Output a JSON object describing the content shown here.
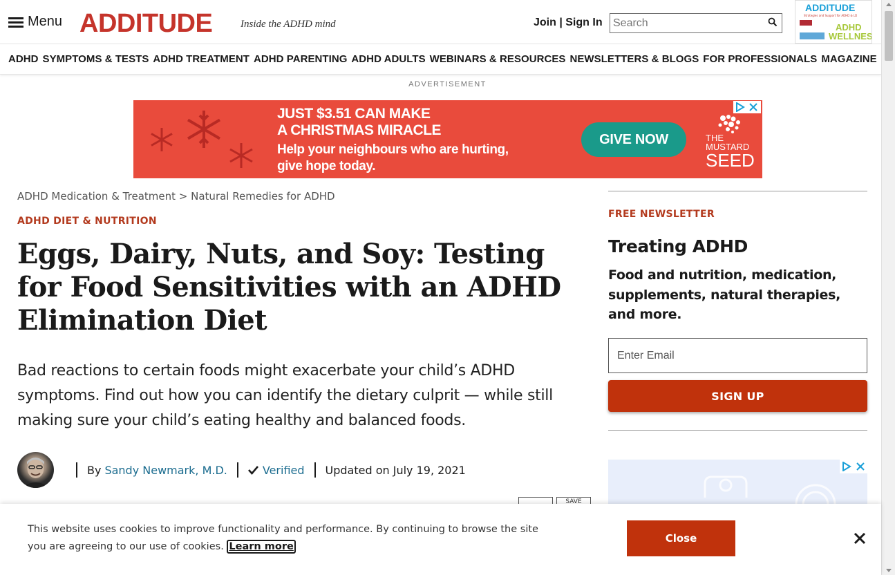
{
  "header": {
    "menu_label": "Menu",
    "logo": "ADDITUDE",
    "tagline": "Inside the ADHD mind",
    "join_signin": "Join | Sign In",
    "search_placeholder": "Search",
    "magazine": {
      "title": "ADDITUDE",
      "subtitle": "Strategies and Support for ADHD & LD",
      "wellness_line1": "ADHD",
      "wellness_line2": "WELLNESS"
    }
  },
  "nav": {
    "items": [
      "ADHD",
      "SYMPTOMS & TESTS",
      "ADHD TREATMENT",
      "ADHD PARENTING",
      "ADHD ADULTS",
      "WEBINARS & RESOURCES",
      "NEWSLETTERS & BLOGS",
      "FOR PROFESSIONALS",
      "MAGAZINE"
    ]
  },
  "ad": {
    "label": "ADVERTISEMENT",
    "headline_1": "JUST $3.51 CAN MAKE",
    "headline_2": "A CHRISTMAS MIRACLE",
    "sub_1": "Help your neighbours who are hurting,",
    "sub_2": "give hope today.",
    "cta": "GIVE NOW",
    "brand_1": "THE",
    "brand_2": "MUSTARD",
    "brand_3": "SEED"
  },
  "article": {
    "breadcrumb_1": "ADHD Medication & Treatment",
    "breadcrumb_sep": ">",
    "breadcrumb_2": "Natural Remedies for ADHD",
    "category": "ADHD DIET & NUTRITION",
    "title": "Eggs, Dairy, Nuts, and Soy: Testing for Food Sensitivities with an ADHD Elimination Diet",
    "subtitle": "Bad reactions to certain foods might exacerbate your child’s ADHD symptoms. Find out how you can identify the dietary culprit — while still making sure your child’s eating healthy and balanced foods.",
    "by": "By",
    "author": "Sandy Newmark, M.D.",
    "verified": "Verified",
    "updated": "Updated on July 19, 2021",
    "save_label": "SAVE"
  },
  "sidebar": {
    "free_newsletter": "FREE NEWSLETTER",
    "title": "Treating ADHD",
    "description": "Food and nutrition, medication, supplements, natural therapies, and more.",
    "email_placeholder": "Enter Email",
    "signup_label": "SIGN UP"
  },
  "cookie": {
    "text": "This website uses cookies to improve functionality and performance. By continuing to browse the site you are agreeing to our use of cookies.",
    "learn_more": "Learn more",
    "close_label": "Close"
  },
  "colors": {
    "brand_red": "#c5342b",
    "accent_orange": "#c0320c",
    "category_red": "#b33a1e",
    "link_teal": "#1b6c8f",
    "ad_red": "#e94b3c",
    "ad_teal": "#1a9a8a"
  }
}
